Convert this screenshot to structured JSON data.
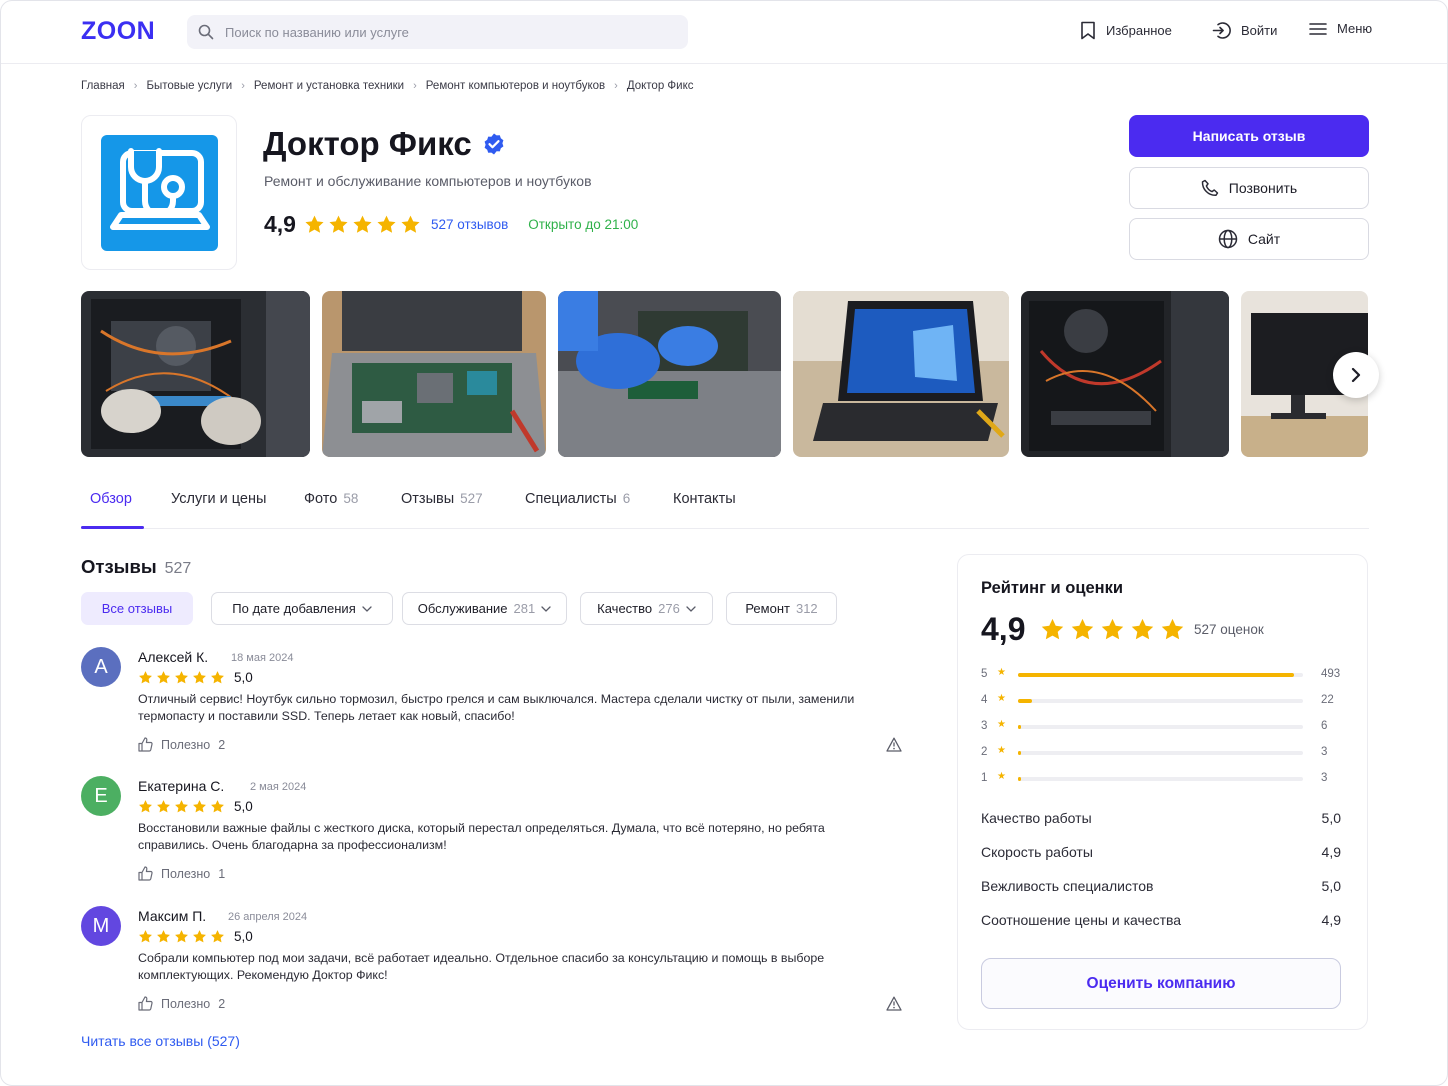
{
  "header": {
    "logo": "ZOON",
    "search_placeholder": "Поиск по названию или услуге",
    "favorites": "Избранное",
    "login": "Войти",
    "menu": "Меню"
  },
  "breadcrumb": [
    "Главная",
    "Бытовые услуги",
    "Ремонт и установка техники",
    "Ремонт компьютеров и ноутбуков",
    "Доктор Фикс"
  ],
  "company": {
    "name": "Доктор Фикс",
    "subtitle": "Ремонт и обслуживание компьютеров и ноутбуков",
    "rating": "4,9",
    "reviews_link": "527 отзывов",
    "open_status": "Открыто до 21:00",
    "rating_stars": 5
  },
  "actions": {
    "write_review": "Написать отзыв",
    "call": "Позвонить",
    "site": "Сайт"
  },
  "tabs": [
    {
      "label": "Обзор",
      "count": ""
    },
    {
      "label": "Услуги и цены",
      "count": ""
    },
    {
      "label": "Фото",
      "count": "58"
    },
    {
      "label": "Отзывы",
      "count": "527"
    },
    {
      "label": "Специалисты",
      "count": "6"
    },
    {
      "label": "Контакты",
      "count": ""
    }
  ],
  "reviews": {
    "title": "Отзывы",
    "count": "527",
    "filters": [
      {
        "label": "Все отзывы",
        "count": ""
      },
      {
        "label": "По дате добавления",
        "count": ""
      },
      {
        "label": "Обслуживание",
        "count": "281"
      },
      {
        "label": "Качество",
        "count": "276"
      },
      {
        "label": "Ремонт",
        "count": "312"
      }
    ],
    "helpful_label": "Полезно",
    "items": [
      {
        "initial": "А",
        "name": "Алексей К.",
        "date": "18 мая 2024",
        "score": "5,0",
        "text": "Отличный сервис! Ноутбук сильно тормозил, быстро грелся и сам выключался. Мастера сделали чистку от пыли, заменили термопасту и поставили SSD. Теперь летает как новый, спасибо!",
        "helpful": "2",
        "avatar_color": "#5b6fbf"
      },
      {
        "initial": "Е",
        "name": "Екатерина С.",
        "date": "2 мая 2024",
        "score": "5,0",
        "text": "Восстановили важные файлы с жесткого диска, который перестал определяться. Думала, что всё потеряно, но ребята справились. Очень благодарна за профессионализм!",
        "helpful": "1",
        "avatar_color": "#4caf62"
      },
      {
        "initial": "М",
        "name": "Максим П.",
        "date": "26 апреля 2024",
        "score": "5,0",
        "text": "Собрали компьютер под мои задачи, всё работает идеально. Отдельное спасибо за консультацию и помощь в выборе комплектующих. Рекомендую Доктор Фикс!",
        "helpful": "2",
        "avatar_color": "#6247e0"
      }
    ],
    "read_all": "Читать все отзывы (527)"
  },
  "rating_panel": {
    "title": "Рейтинг и оценки",
    "score": "4,9",
    "count_label": "527 оценок",
    "distribution": [
      {
        "stars": "5",
        "count": "493",
        "fraction": 0.97
      },
      {
        "stars": "4",
        "count": "22",
        "fraction": 0.05
      },
      {
        "stars": "3",
        "count": "6",
        "fraction": 0.012
      },
      {
        "stars": "2",
        "count": "3",
        "fraction": 0.008
      },
      {
        "stars": "1",
        "count": "3",
        "fraction": 0.008
      }
    ],
    "aspects": [
      {
        "label": "Качество работы",
        "value": "5,0"
      },
      {
        "label": "Скорость работы",
        "value": "4,9"
      },
      {
        "label": "Вежливость специалистов",
        "value": "5,0"
      },
      {
        "label": "Соотношение цены и качества",
        "value": "4,9"
      }
    ],
    "rate_button": "Оценить компанию"
  },
  "colors": {
    "brand": "#4b2bf0",
    "star": "#f5b400",
    "link": "#2f5bf0",
    "open": "#2fb14a"
  }
}
